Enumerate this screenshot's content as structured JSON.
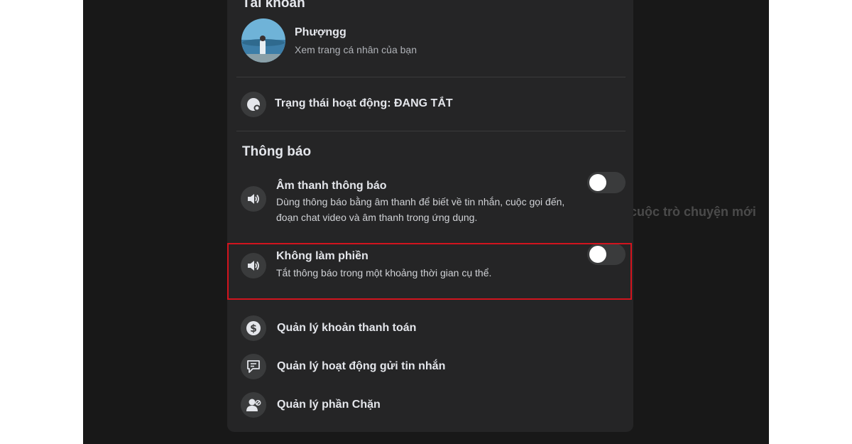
{
  "background_hint": "cuộc trò chuyện mới",
  "account": {
    "section_title": "Tài khoản",
    "name": "Phượngg",
    "subtitle": "Xem trang cá nhân của bạn"
  },
  "activity_status": {
    "label": "Trạng thái hoạt động: ĐANG TẮT"
  },
  "notifications": {
    "section_title": "Thông báo",
    "sound": {
      "label": "Âm thanh thông báo",
      "description": "Dùng thông báo bằng âm thanh để biết về tin nhắn, cuộc gọi đến, đoạn chat video và âm thanh trong ứng dụng.",
      "enabled": false
    },
    "dnd": {
      "label": "Không làm phiền",
      "description": "Tắt thông báo trong một khoảng thời gian cụ thể.",
      "enabled": false
    }
  },
  "menu": {
    "payments": "Quản lý khoản thanh toán",
    "message_delivery": "Quản lý hoạt động gửi tin nhắn",
    "blocking": "Quản lý phần Chặn"
  },
  "colors": {
    "highlight_border": "#d2141e",
    "panel_bg": "#252526",
    "page_bg": "#181818"
  }
}
